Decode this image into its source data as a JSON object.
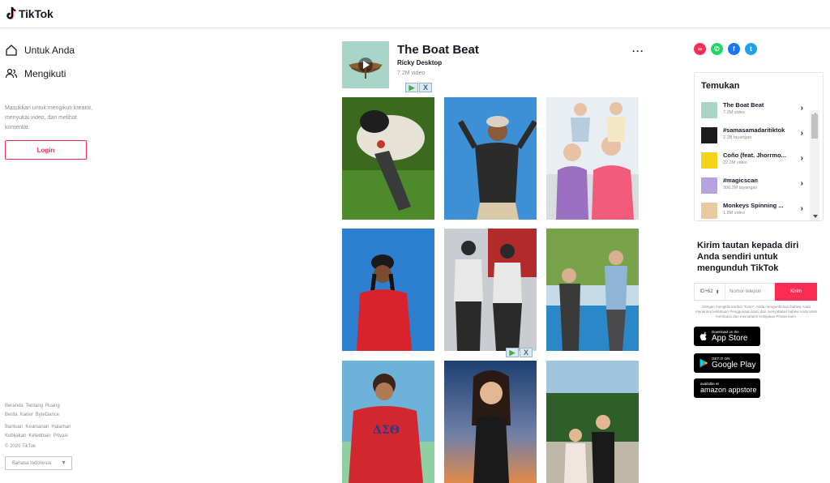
{
  "header": {
    "logo_text": "TikTok"
  },
  "sidebar": {
    "nav": [
      {
        "label": "Untuk Anda",
        "icon": "home-icon"
      },
      {
        "label": "Mengikuti",
        "icon": "users-icon"
      }
    ],
    "login_hint": "Masukkan untuk mengikuti kreator, menyukai video, dan melihat komentar.",
    "login_label": "Login",
    "footer_row1": [
      "Beranda",
      "Tentang",
      "Ruang Berita",
      "Karier",
      "ByteDance"
    ],
    "footer_row2": [
      "Bantuan",
      "Keamanan",
      "Halaman Kebijakan",
      "Ketentuan",
      "Privasi"
    ],
    "copyright": "© 2020 TikTok",
    "language": "Bahasa Indonesia"
  },
  "music": {
    "title": "The Boat Beat",
    "artist": "Ricky Desktop",
    "video_count": "7.2M video",
    "more": "···"
  },
  "videos": [
    {
      "id": "video-1",
      "colors": [
        "#3b6a1f",
        "#d7e4c3"
      ]
    },
    {
      "id": "video-2",
      "colors": [
        "#3d8fd6",
        "#2b2b2b"
      ]
    },
    {
      "id": "video-3",
      "colors": [
        "#e9eef2",
        "#f25c7a"
      ]
    },
    {
      "id": "video-4",
      "colors": [
        "#2d7fd0",
        "#d9232c"
      ]
    },
    {
      "id": "video-5",
      "colors": [
        "#c9ccd1",
        "#2a2a2a"
      ]
    },
    {
      "id": "video-6",
      "colors": [
        "#79a34b",
        "#2b87c7"
      ]
    },
    {
      "id": "video-7",
      "colors": [
        "#6cb2d9",
        "#d2272f"
      ]
    },
    {
      "id": "video-8",
      "colors": [
        "#1d3f71",
        "#e08a4a"
      ]
    },
    {
      "id": "video-9",
      "colors": [
        "#9fc5de",
        "#2f5e2b"
      ]
    }
  ],
  "ad_overlay": {
    "play": "▶",
    "close": "X"
  },
  "share_icons": [
    {
      "name": "link-icon",
      "color": "#fe2c55",
      "glyph": "∞"
    },
    {
      "name": "whatsapp-icon",
      "color": "#25d366",
      "glyph": "✆"
    },
    {
      "name": "facebook-icon",
      "color": "#1877f2",
      "glyph": "f"
    },
    {
      "name": "twitter-icon",
      "color": "#1da1f2",
      "glyph": "t"
    }
  ],
  "discover": {
    "title": "Temukan",
    "items": [
      {
        "name": "The Boat Beat",
        "meta": "7.2M video",
        "thumb_color": "#a8d5c8"
      },
      {
        "name": "#samasamadaritiktok",
        "meta": "2.2B tayangan",
        "thumb_color": "#1c1c1c"
      },
      {
        "name": "Coño (feat. Jhorrmo...",
        "meta": "22.2M video",
        "thumb_color": "#f4d21a"
      },
      {
        "name": "#magicscan",
        "meta": "306.2M tayangan",
        "thumb_color": "#b8a1e0"
      },
      {
        "name": "Monkeys Spinning ...",
        "meta": "1.8M video",
        "thumb_color": "#e8c9a0"
      }
    ]
  },
  "send_link": {
    "title": "Kirim tautan kepada diri Anda sendiri untuk mengunduh TikTok",
    "country_code": "ID+62",
    "phone_placeholder": "Nomor telepon",
    "send_label": "Kirim",
    "disclaimer": "Dengan mengklik tombol \"Kirim\", Anda mengonfirmasi bahwa Anda menerima ketentuan Penggunaan kami dan menyatakan bahwa Anda telah membaca dan memahami Kebijakan Privasi kami."
  },
  "stores": [
    {
      "small": "Download on the",
      "big": "App Store",
      "icon": "apple-icon"
    },
    {
      "small": "GET IT ON",
      "big": "Google Play",
      "icon": "google-play-icon"
    },
    {
      "small": "available at",
      "big": "amazon appstore",
      "icon": "amazon-icon"
    }
  ]
}
